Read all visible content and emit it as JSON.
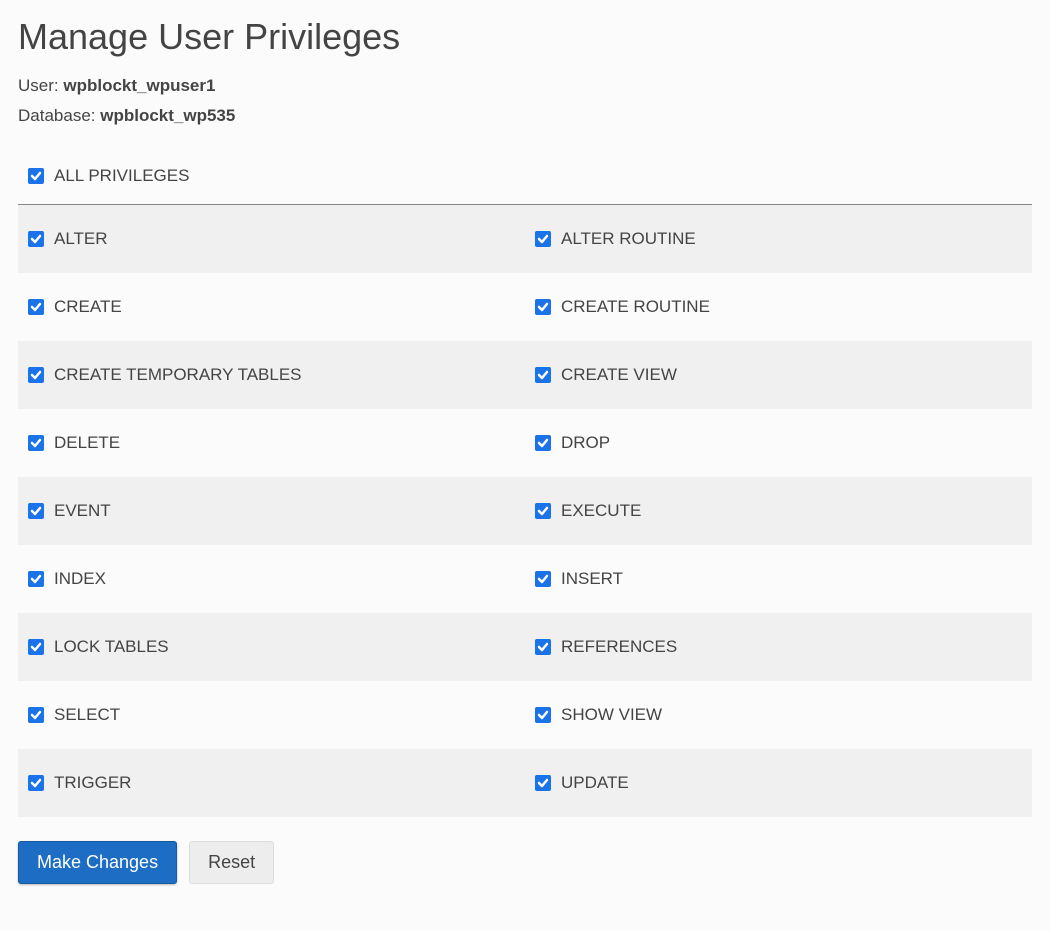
{
  "page": {
    "title": "Manage User Privileges"
  },
  "info": {
    "user_label": "User:",
    "user_value": "wpblockt_wpuser1",
    "db_label": "Database:",
    "db_value": "wpblockt_wp535"
  },
  "all_privileges": {
    "label": "ALL PRIVILEGES",
    "checked": true
  },
  "privileges": [
    {
      "left": {
        "label": "ALTER",
        "checked": true
      },
      "right": {
        "label": "ALTER ROUTINE",
        "checked": true
      }
    },
    {
      "left": {
        "label": "CREATE",
        "checked": true
      },
      "right": {
        "label": "CREATE ROUTINE",
        "checked": true
      }
    },
    {
      "left": {
        "label": "CREATE TEMPORARY TABLES",
        "checked": true
      },
      "right": {
        "label": "CREATE VIEW",
        "checked": true
      }
    },
    {
      "left": {
        "label": "DELETE",
        "checked": true
      },
      "right": {
        "label": "DROP",
        "checked": true
      }
    },
    {
      "left": {
        "label": "EVENT",
        "checked": true
      },
      "right": {
        "label": "EXECUTE",
        "checked": true
      }
    },
    {
      "left": {
        "label": "INDEX",
        "checked": true
      },
      "right": {
        "label": "INSERT",
        "checked": true
      }
    },
    {
      "left": {
        "label": "LOCK TABLES",
        "checked": true
      },
      "right": {
        "label": "REFERENCES",
        "checked": true
      }
    },
    {
      "left": {
        "label": "SELECT",
        "checked": true
      },
      "right": {
        "label": "SHOW VIEW",
        "checked": true
      }
    },
    {
      "left": {
        "label": "TRIGGER",
        "checked": true
      },
      "right": {
        "label": "UPDATE",
        "checked": true
      }
    }
  ],
  "actions": {
    "make_changes": "Make Changes",
    "reset": "Reset"
  },
  "colors": {
    "checkbox": "#1a73e8",
    "primary_button": "#1d6dc4"
  }
}
